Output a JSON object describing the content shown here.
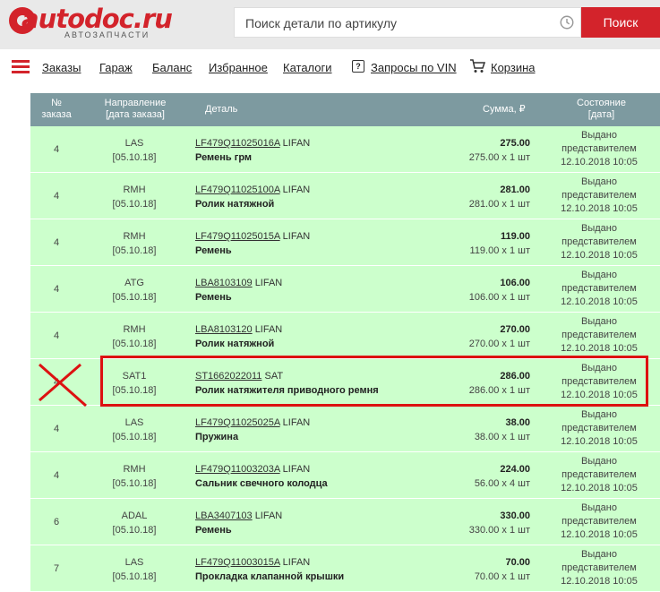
{
  "header": {
    "logo_text": "autodoc.ru",
    "logo_subtitle": "АВТОЗАПЧАСТИ",
    "search_placeholder": "Поиск детали по артикулу",
    "search_button": "Поиск"
  },
  "nav": {
    "items": [
      "Заказы",
      "Гараж",
      "Баланс",
      "Избранное",
      "Каталоги",
      "Запросы по VIN",
      "Корзина"
    ]
  },
  "table": {
    "headers": {
      "order_no_1": "№",
      "order_no_2": "заказа",
      "direction_1": "Направление",
      "direction_2": "[дата заказа]",
      "detail": "Деталь",
      "sum": "Сумма, ₽",
      "state_1": "Состояние",
      "state_2": "[дата]"
    },
    "rows": [
      {
        "num": "4",
        "dir": "LAS",
        "date": "[05.10.18]",
        "art": "LF479Q11025016A",
        "brand": "LIFAN",
        "name": "Ремень грм",
        "total": "275.00",
        "calc": "275.00 x 1 шт",
        "state1": "Выдано",
        "state2": "представителем",
        "state3": "12.10.2018 10:05"
      },
      {
        "num": "4",
        "dir": "RMH",
        "date": "[05.10.18]",
        "art": "LF479Q11025100A",
        "brand": "LIFAN",
        "name": "Ролик натяжной",
        "total": "281.00",
        "calc": "281.00 x 1 шт",
        "state1": "Выдано",
        "state2": "представителем",
        "state3": "12.10.2018 10:05"
      },
      {
        "num": "4",
        "dir": "RMH",
        "date": "[05.10.18]",
        "art": "LF479Q11025015A",
        "brand": "LIFAN",
        "name": "Ремень",
        "total": "119.00",
        "calc": "119.00 x 1 шт",
        "state1": "Выдано",
        "state2": "представителем",
        "state3": "12.10.2018 10:05"
      },
      {
        "num": "4",
        "dir": "ATG",
        "date": "[05.10.18]",
        "art": "LBA8103109",
        "brand": "LIFAN",
        "name": "Ремень",
        "total": "106.00",
        "calc": "106.00 x 1 шт",
        "state1": "Выдано",
        "state2": "представителем",
        "state3": "12.10.2018 10:05"
      },
      {
        "num": "4",
        "dir": "RMH",
        "date": "[05.10.18]",
        "art": "LBA8103120",
        "brand": "LIFAN",
        "name": "Ролик натяжной",
        "total": "270.00",
        "calc": "270.00 x 1 шт",
        "state1": "Выдано",
        "state2": "представителем",
        "state3": "12.10.2018 10:05"
      },
      {
        "num": "4",
        "dir": "SAT1",
        "date": "[05.10.18]",
        "art": "ST1662022011",
        "brand": "SAT",
        "name": "Ролик натяжителя приводного ремня",
        "total": "286.00",
        "calc": "286.00 x 1 шт",
        "state1": "Выдано",
        "state2": "представителем",
        "state3": "12.10.2018 10:05"
      },
      {
        "num": "4",
        "dir": "LAS",
        "date": "[05.10.18]",
        "art": "LF479Q11025025A",
        "brand": "LIFAN",
        "name": "Пружина",
        "total": "38.00",
        "calc": "38.00 x 1 шт",
        "state1": "Выдано",
        "state2": "представителем",
        "state3": "12.10.2018 10:05"
      },
      {
        "num": "4",
        "dir": "RMH",
        "date": "[05.10.18]",
        "art": "LF479Q11003203A",
        "brand": "LIFAN",
        "name": "Сальник свечного колодца",
        "total": "224.00",
        "calc": "56.00 x 4 шт",
        "state1": "Выдано",
        "state2": "представителем",
        "state3": "12.10.2018 10:05"
      },
      {
        "num": "6",
        "dir": "ADAL",
        "date": "[05.10.18]",
        "art": "LBA3407103",
        "brand": "LIFAN",
        "name": "Ремень",
        "total": "330.00",
        "calc": "330.00 x 1 шт",
        "state1": "Выдано",
        "state2": "представителем",
        "state3": "12.10.2018 10:05"
      },
      {
        "num": "7",
        "dir": "LAS",
        "date": "[05.10.18]",
        "art": "LF479Q11003015A",
        "brand": "LIFAN",
        "name": "Прокладка клапанной крышки",
        "total": "70.00",
        "calc": "70.00 x 1 шт",
        "state1": "Выдано",
        "state2": "представителем",
        "state3": "12.10.2018 10:05"
      }
    ]
  },
  "colors": {
    "brand_red": "#d3232b",
    "header_bg": "#7d9aa0",
    "row_bg": "#ccffcc",
    "annotation_red": "#dd1111"
  }
}
